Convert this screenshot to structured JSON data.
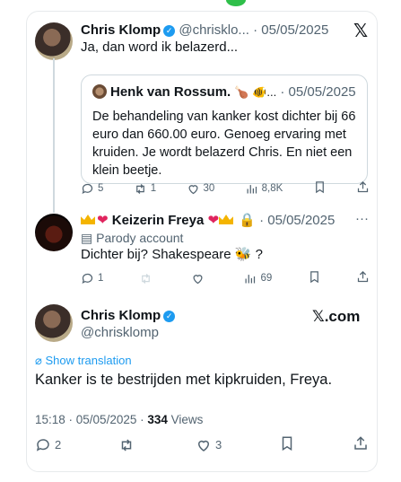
{
  "tweet1": {
    "name": "Chris Klomp",
    "handle_time": "@chrisklo... · 05/05/2025",
    "text": "Ja, dan word ik belazerd...",
    "quote": {
      "name": "Henk van Rossum.",
      "emoji": "🍗 🐠...",
      "time": "· 05/05/2025",
      "text": "De behandeling van kanker kost dichter bij 66 euro dan 660.00 euro. Genoeg ervaring met kruiden. Je wordt belazerd Chris. En niet een klein beetje."
    },
    "replies": "5",
    "retweets": "1",
    "likes": "30",
    "views": "8,8K"
  },
  "tweet2": {
    "name": "Keizerin Freya",
    "time": "· 05/05/2025",
    "more": "···",
    "parody": "Parody account",
    "text": "Dichter bij? Shakespeare",
    "text_end": "?",
    "bee": "🐝",
    "replies": "1",
    "views": "69"
  },
  "tweet3": {
    "name": "Chris Klomp",
    "handle": "@chrisklomp",
    "brand": "𝕏.com",
    "translate": "Show translation",
    "text": "Kanker is te bestrijden met kipkruiden, Freya.",
    "time": "15:18 · 05/05/2025 · ",
    "views_count": "334",
    "views_label": " Views",
    "replies": "2",
    "likes": "3"
  },
  "x_logo": "𝕏"
}
